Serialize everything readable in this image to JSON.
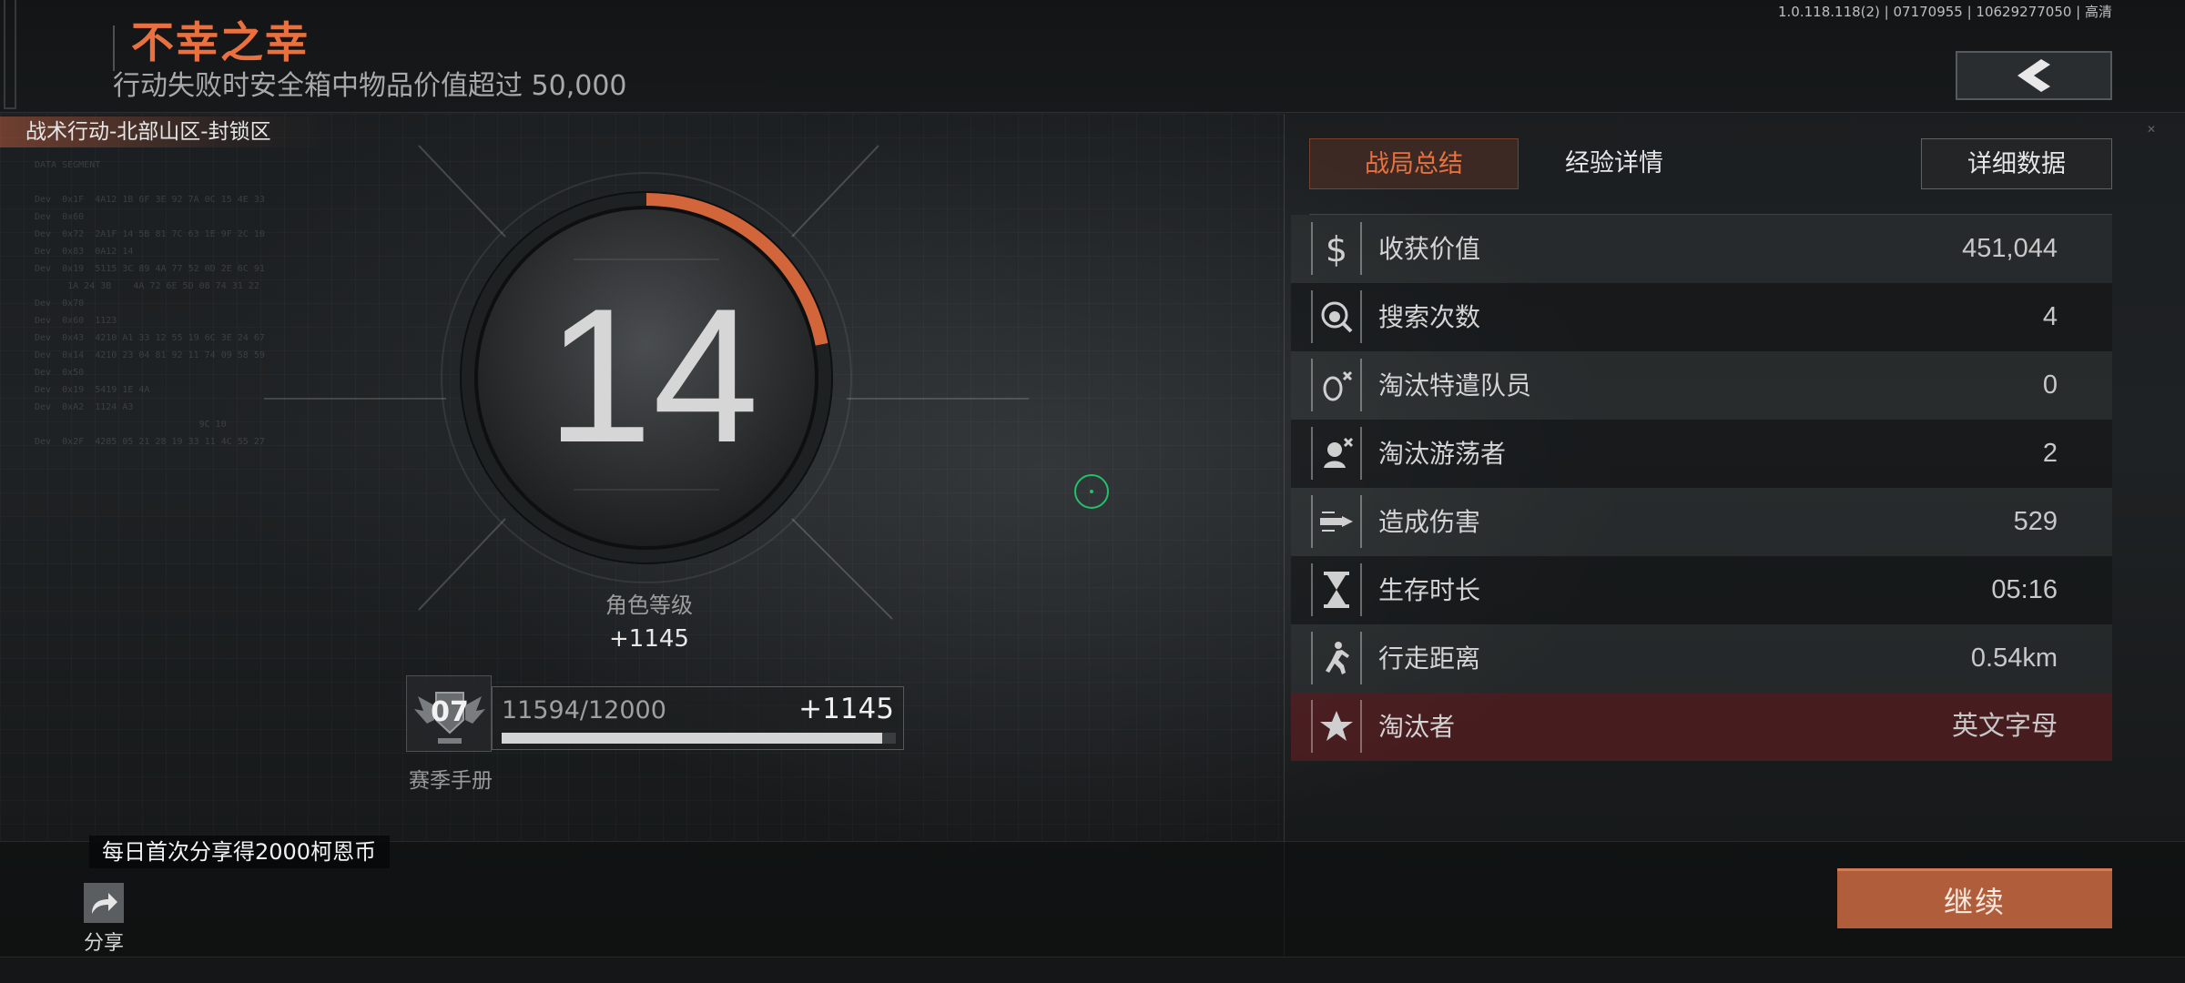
{
  "header": {
    "title": "不幸之幸",
    "subtitle": "行动失败时安全箱中物品价值超过 50,000",
    "version": "1.0.118.118(2) | 07170955 | 10629277050 | 高清"
  },
  "location": "战术行动-北部山区-封锁区",
  "level": {
    "value": "14",
    "label": "角色等级",
    "xp_gain": "+1145",
    "ring_fraction": 0.22
  },
  "season_pass": {
    "level": "07",
    "label": "赛季手册",
    "progress_text": "11594/12000",
    "progress_fraction": 0.966,
    "gain": "+1145"
  },
  "share": {
    "tip": "每日首次分享得2000柯恩币",
    "label": "分享"
  },
  "continue_label": "继续",
  "tabs": {
    "summary": "战局总结",
    "experience": "经验详情",
    "details": "详细数据"
  },
  "stats": [
    {
      "icon": "dollar-icon",
      "label": "收获价值",
      "value": "451,044"
    },
    {
      "icon": "search-icon",
      "label": "搜索次数",
      "value": "4"
    },
    {
      "icon": "operator-kill-icon",
      "label": "淘汰特遣队员",
      "value": "0"
    },
    {
      "icon": "wanderer-kill-icon",
      "label": "淘汰游荡者",
      "value": "2"
    },
    {
      "icon": "damage-icon",
      "label": "造成伤害",
      "value": "529"
    },
    {
      "icon": "hourglass-icon",
      "label": "生存时长",
      "value": "05:16"
    },
    {
      "icon": "walking-icon",
      "label": "行走距离",
      "value": "0.54km"
    },
    {
      "icon": "star-icon",
      "label": "淘汰者",
      "value": "英文字母"
    }
  ],
  "colors": {
    "accent": "#e8713f",
    "continue": "#b05d3c",
    "highlight_row": "#6e1e20",
    "crosshair": "#22c06a"
  }
}
